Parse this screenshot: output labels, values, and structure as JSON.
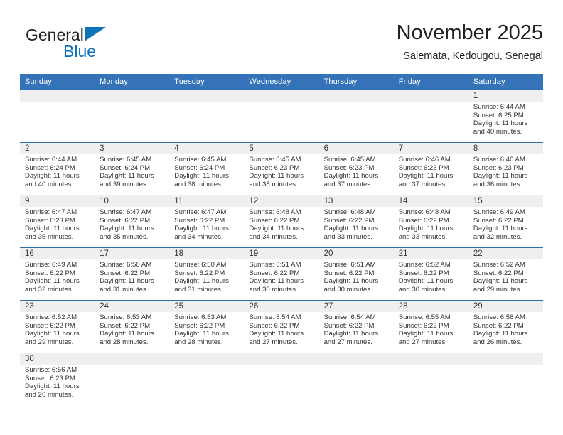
{
  "brand": {
    "name_part1": "General",
    "name_part2": "Blue",
    "logo_icon": "triangle-flag-icon",
    "accent_color": "#1072b8"
  },
  "header": {
    "title": "November 2025",
    "subtitle": "Salemata, Kedougou, Senegal"
  },
  "calendar": {
    "header_bg": "#3573b9",
    "daynum_band_bg": "#efefef",
    "row_border_color": "#2e6fa7",
    "weekday_headers": [
      "Sunday",
      "Monday",
      "Tuesday",
      "Wednesday",
      "Thursday",
      "Friday",
      "Saturday"
    ],
    "weeks": [
      [
        {
          "day": "",
          "lines": []
        },
        {
          "day": "",
          "lines": []
        },
        {
          "day": "",
          "lines": []
        },
        {
          "day": "",
          "lines": []
        },
        {
          "day": "",
          "lines": []
        },
        {
          "day": "",
          "lines": []
        },
        {
          "day": "1",
          "lines": [
            "Sunrise: 6:44 AM",
            "Sunset: 6:25 PM",
            "Daylight: 11 hours",
            "and 40 minutes."
          ]
        }
      ],
      [
        {
          "day": "2",
          "lines": [
            "Sunrise: 6:44 AM",
            "Sunset: 6:24 PM",
            "Daylight: 11 hours",
            "and 40 minutes."
          ]
        },
        {
          "day": "3",
          "lines": [
            "Sunrise: 6:45 AM",
            "Sunset: 6:24 PM",
            "Daylight: 11 hours",
            "and 39 minutes."
          ]
        },
        {
          "day": "4",
          "lines": [
            "Sunrise: 6:45 AM",
            "Sunset: 6:24 PM",
            "Daylight: 11 hours",
            "and 38 minutes."
          ]
        },
        {
          "day": "5",
          "lines": [
            "Sunrise: 6:45 AM",
            "Sunset: 6:23 PM",
            "Daylight: 11 hours",
            "and 38 minutes."
          ]
        },
        {
          "day": "6",
          "lines": [
            "Sunrise: 6:45 AM",
            "Sunset: 6:23 PM",
            "Daylight: 11 hours",
            "and 37 minutes."
          ]
        },
        {
          "day": "7",
          "lines": [
            "Sunrise: 6:46 AM",
            "Sunset: 6:23 PM",
            "Daylight: 11 hours",
            "and 37 minutes."
          ]
        },
        {
          "day": "8",
          "lines": [
            "Sunrise: 6:46 AM",
            "Sunset: 6:23 PM",
            "Daylight: 11 hours",
            "and 36 minutes."
          ]
        }
      ],
      [
        {
          "day": "9",
          "lines": [
            "Sunrise: 6:47 AM",
            "Sunset: 6:23 PM",
            "Daylight: 11 hours",
            "and 35 minutes."
          ]
        },
        {
          "day": "10",
          "lines": [
            "Sunrise: 6:47 AM",
            "Sunset: 6:22 PM",
            "Daylight: 11 hours",
            "and 35 minutes."
          ]
        },
        {
          "day": "11",
          "lines": [
            "Sunrise: 6:47 AM",
            "Sunset: 6:22 PM",
            "Daylight: 11 hours",
            "and 34 minutes."
          ]
        },
        {
          "day": "12",
          "lines": [
            "Sunrise: 6:48 AM",
            "Sunset: 6:22 PM",
            "Daylight: 11 hours",
            "and 34 minutes."
          ]
        },
        {
          "day": "13",
          "lines": [
            "Sunrise: 6:48 AM",
            "Sunset: 6:22 PM",
            "Daylight: 11 hours",
            "and 33 minutes."
          ]
        },
        {
          "day": "14",
          "lines": [
            "Sunrise: 6:48 AM",
            "Sunset: 6:22 PM",
            "Daylight: 11 hours",
            "and 33 minutes."
          ]
        },
        {
          "day": "15",
          "lines": [
            "Sunrise: 6:49 AM",
            "Sunset: 6:22 PM",
            "Daylight: 11 hours",
            "and 32 minutes."
          ]
        }
      ],
      [
        {
          "day": "16",
          "lines": [
            "Sunrise: 6:49 AM",
            "Sunset: 6:22 PM",
            "Daylight: 11 hours",
            "and 32 minutes."
          ]
        },
        {
          "day": "17",
          "lines": [
            "Sunrise: 6:50 AM",
            "Sunset: 6:22 PM",
            "Daylight: 11 hours",
            "and 31 minutes."
          ]
        },
        {
          "day": "18",
          "lines": [
            "Sunrise: 6:50 AM",
            "Sunset: 6:22 PM",
            "Daylight: 11 hours",
            "and 31 minutes."
          ]
        },
        {
          "day": "19",
          "lines": [
            "Sunrise: 6:51 AM",
            "Sunset: 6:22 PM",
            "Daylight: 11 hours",
            "and 30 minutes."
          ]
        },
        {
          "day": "20",
          "lines": [
            "Sunrise: 6:51 AM",
            "Sunset: 6:22 PM",
            "Daylight: 11 hours",
            "and 30 minutes."
          ]
        },
        {
          "day": "21",
          "lines": [
            "Sunrise: 6:52 AM",
            "Sunset: 6:22 PM",
            "Daylight: 11 hours",
            "and 30 minutes."
          ]
        },
        {
          "day": "22",
          "lines": [
            "Sunrise: 6:52 AM",
            "Sunset: 6:22 PM",
            "Daylight: 11 hours",
            "and 29 minutes."
          ]
        }
      ],
      [
        {
          "day": "23",
          "lines": [
            "Sunrise: 6:52 AM",
            "Sunset: 6:22 PM",
            "Daylight: 11 hours",
            "and 29 minutes."
          ]
        },
        {
          "day": "24",
          "lines": [
            "Sunrise: 6:53 AM",
            "Sunset: 6:22 PM",
            "Daylight: 11 hours",
            "and 28 minutes."
          ]
        },
        {
          "day": "25",
          "lines": [
            "Sunrise: 6:53 AM",
            "Sunset: 6:22 PM",
            "Daylight: 11 hours",
            "and 28 minutes."
          ]
        },
        {
          "day": "26",
          "lines": [
            "Sunrise: 6:54 AM",
            "Sunset: 6:22 PM",
            "Daylight: 11 hours",
            "and 27 minutes."
          ]
        },
        {
          "day": "27",
          "lines": [
            "Sunrise: 6:54 AM",
            "Sunset: 6:22 PM",
            "Daylight: 11 hours",
            "and 27 minutes."
          ]
        },
        {
          "day": "28",
          "lines": [
            "Sunrise: 6:55 AM",
            "Sunset: 6:22 PM",
            "Daylight: 11 hours",
            "and 27 minutes."
          ]
        },
        {
          "day": "29",
          "lines": [
            "Sunrise: 6:56 AM",
            "Sunset: 6:22 PM",
            "Daylight: 11 hours",
            "and 26 minutes."
          ]
        }
      ],
      [
        {
          "day": "30",
          "lines": [
            "Sunrise: 6:56 AM",
            "Sunset: 6:23 PM",
            "Daylight: 11 hours",
            "and 26 minutes."
          ]
        },
        {
          "day": "",
          "lines": []
        },
        {
          "day": "",
          "lines": []
        },
        {
          "day": "",
          "lines": []
        },
        {
          "day": "",
          "lines": []
        },
        {
          "day": "",
          "lines": []
        },
        {
          "day": "",
          "lines": []
        }
      ]
    ]
  }
}
